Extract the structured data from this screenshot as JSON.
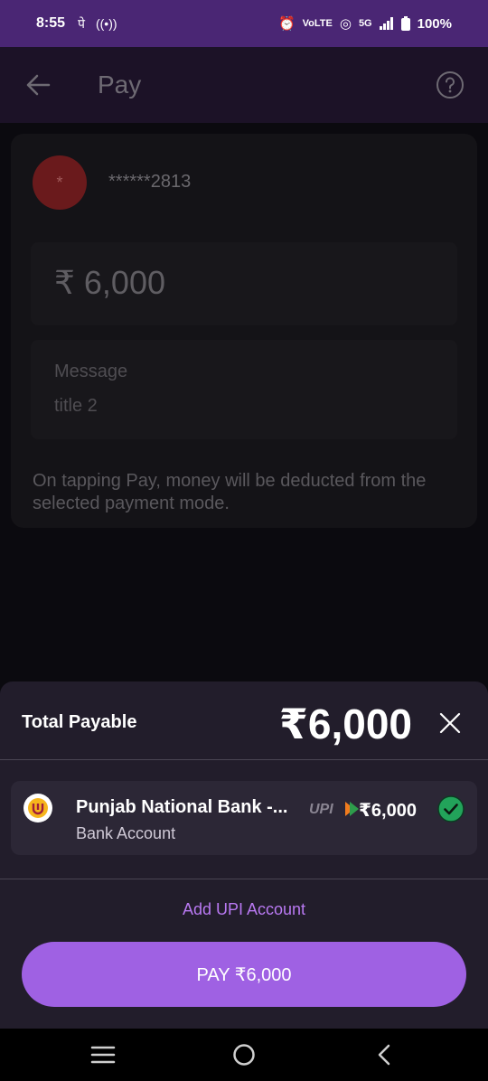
{
  "status_bar": {
    "time": "8:55",
    "carrier_glyph": "पे",
    "network": "5G",
    "battery": "100%",
    "volte": "VoLTE"
  },
  "header": {
    "title": "Pay"
  },
  "payment_form": {
    "payee_masked": "******2813",
    "avatar_initial": "*",
    "amount": "₹ 6,000",
    "message_label": "Message",
    "message_value": "title 2",
    "disclaimer": "On tapping Pay, money will be deducted from the selected payment mode."
  },
  "sheet": {
    "title": "Total Payable",
    "total_amount": "₹6,000",
    "bank": {
      "name": "Punjab National Bank -...",
      "type": "Bank Account",
      "amount": "₹6,000",
      "upi_label": "UPI"
    },
    "add_upi_label": "Add UPI Account",
    "pay_label": "PAY ₹6,000"
  },
  "colors": {
    "accent": "#9f61e3",
    "check": "#22a35a",
    "status_bar": "#4a2674"
  }
}
